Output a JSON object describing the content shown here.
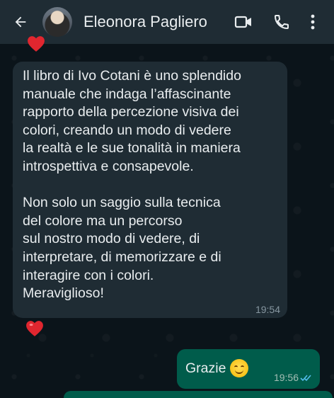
{
  "header": {
    "contact_name": "Eleonora Pagliero",
    "icons": [
      "back-arrow-icon",
      "avatar",
      "video-call-icon",
      "phone-icon",
      "more-options-icon"
    ]
  },
  "messages": [
    {
      "direction": "incoming",
      "text": "Il libro di Ivo Cotani è uno splendido\nmanuale che indaga l’affascinante\nrapporto della percezione visiva dei\ncolori, creando un modo di vedere\nla realtà e le sue tonalità in maniera\nintrospettiva e consapevole.\n\nNon solo un saggio sulla tecnica\ndel colore ma un percorso\nsul nostro modo di vedere, di\ninterpretare, di memorizzare e di\ninteragire con i colori.\nMeraviglioso!",
      "time": "19:54",
      "reaction": "heart"
    },
    {
      "direction": "outgoing",
      "text": "Grazie",
      "emoji": "smiling-face",
      "time": "19:56",
      "status": "read"
    }
  ],
  "colors": {
    "header_bg": "#1f2c34",
    "chat_bg": "#0b141a",
    "incoming_bubble": "#1f2c34",
    "outgoing_bubble": "#005c4b",
    "read_ticks": "#53bdeb",
    "heart": "#e0262f"
  }
}
